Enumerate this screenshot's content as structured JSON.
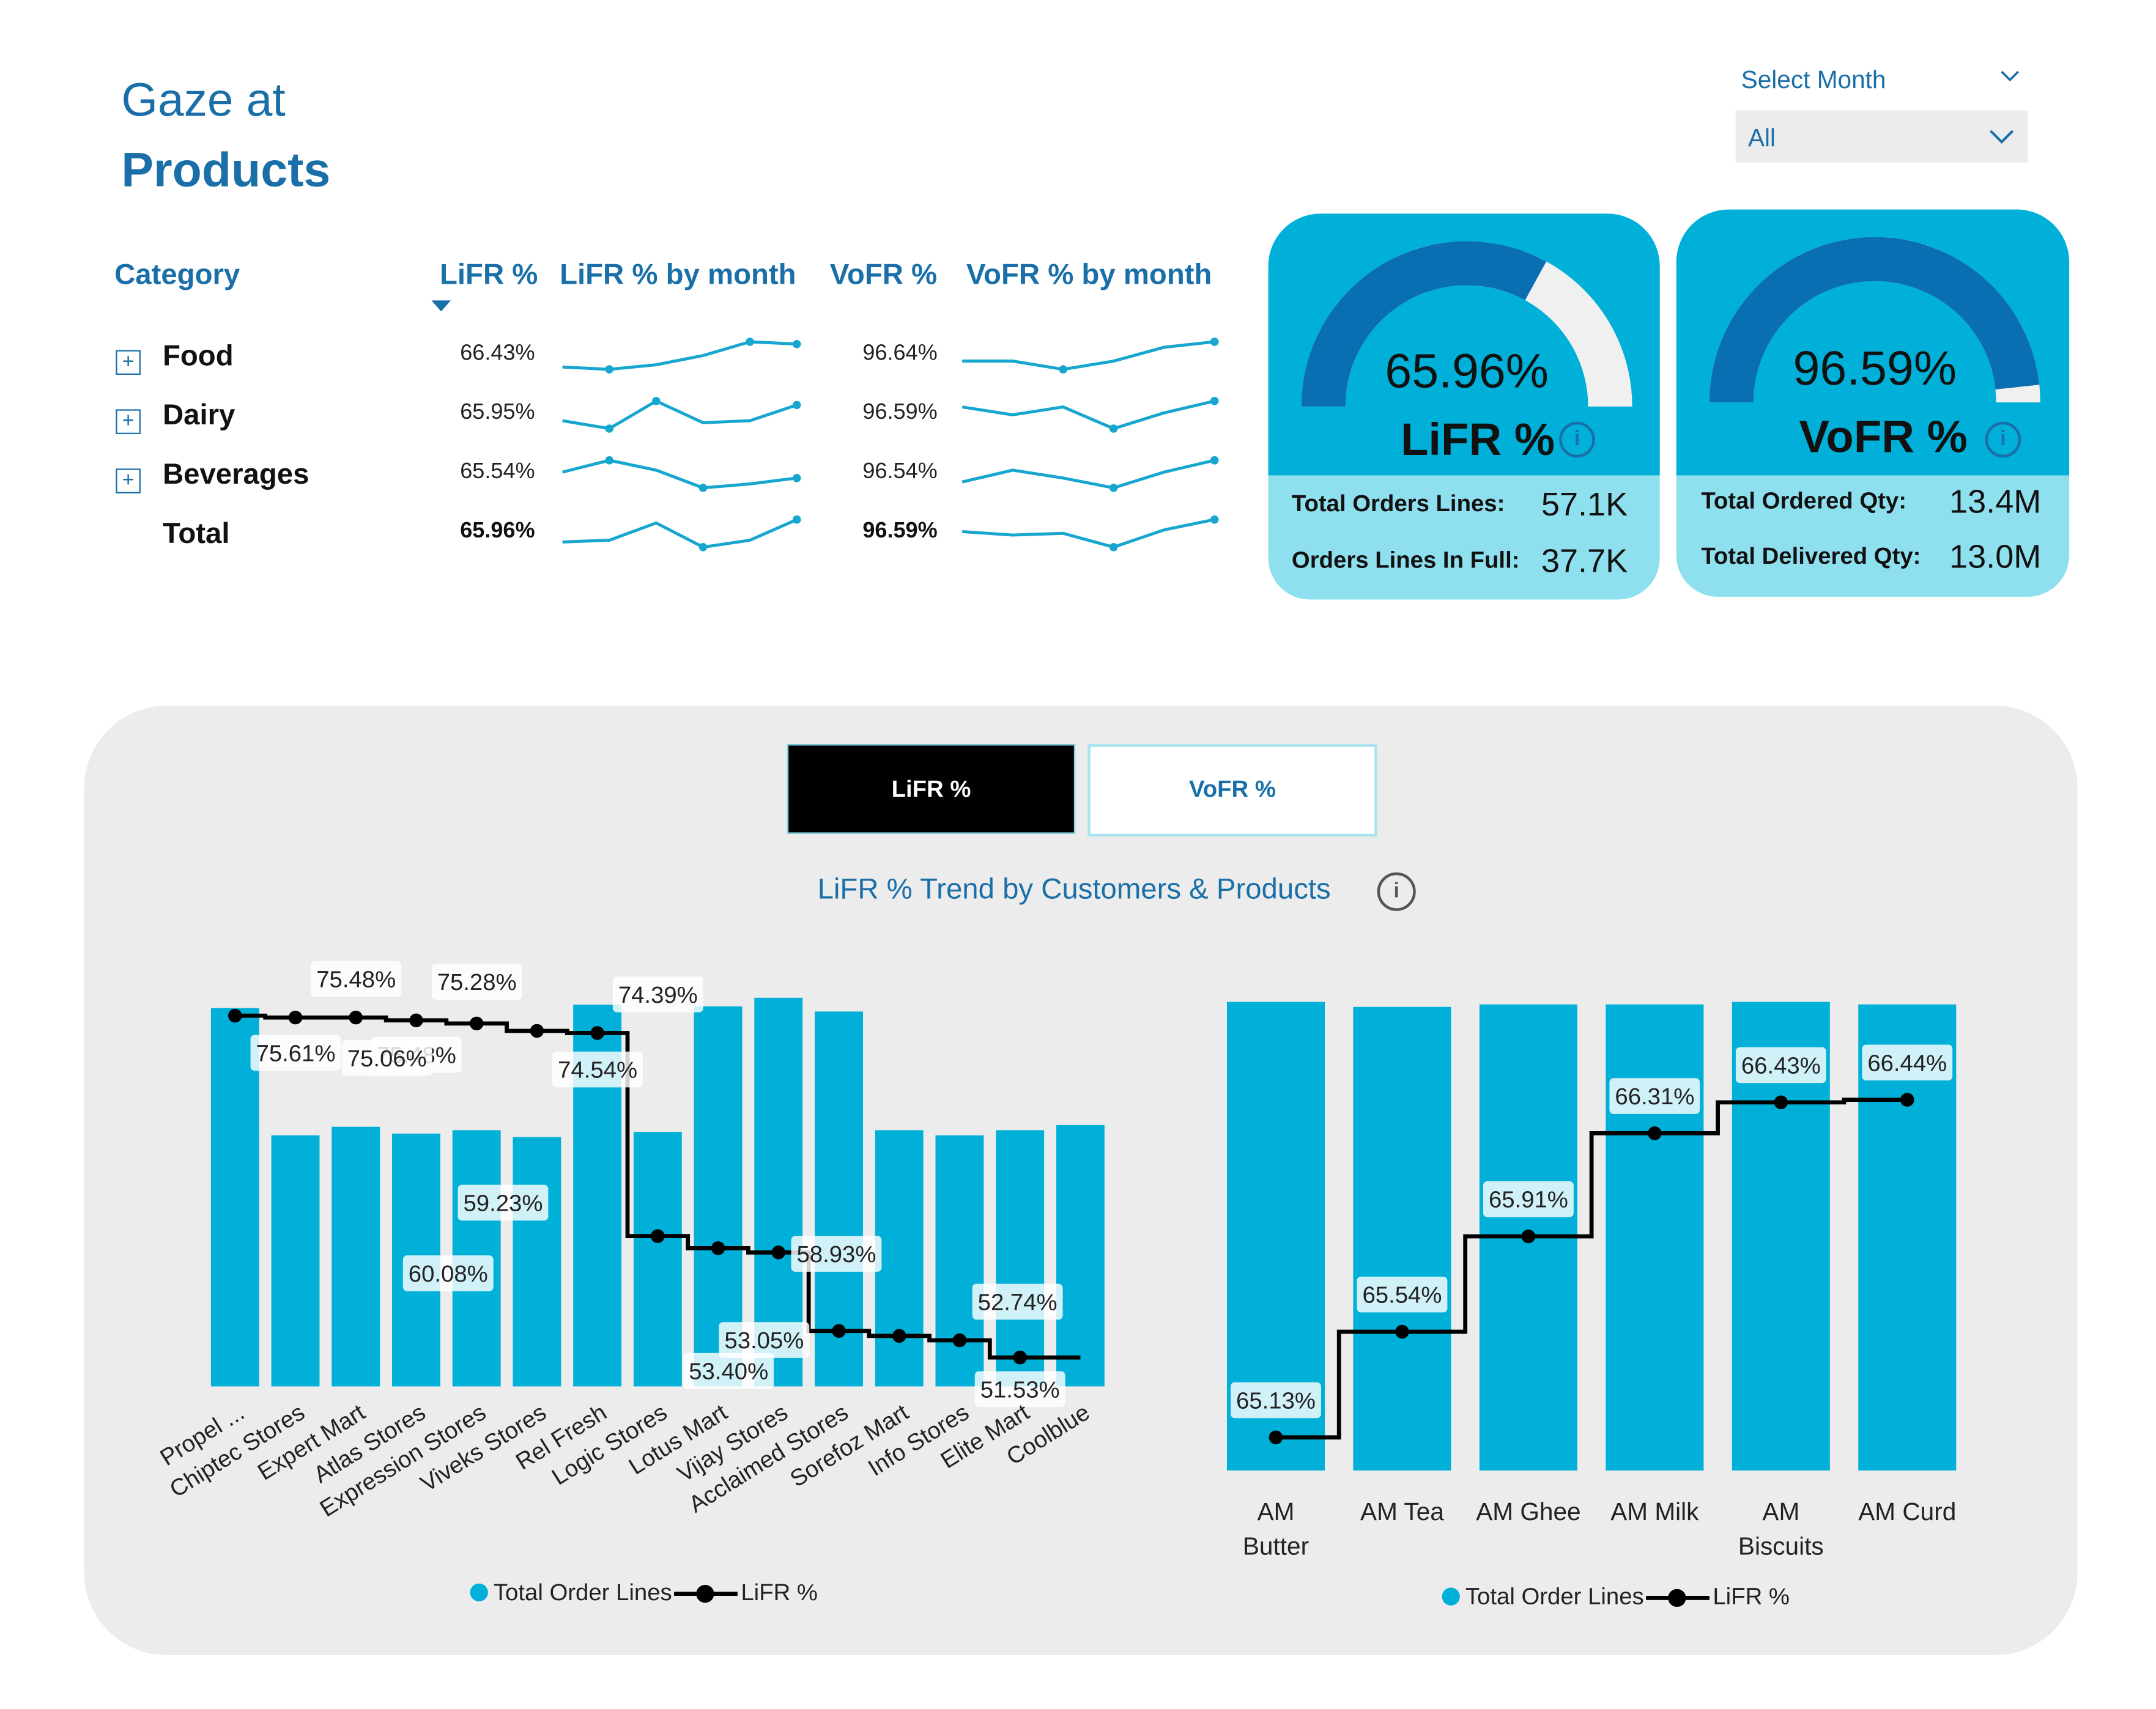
{
  "header": {
    "title_line1": "Gaze at",
    "title_line2": "Products"
  },
  "month_filter": {
    "label": "Select Month",
    "value": "All"
  },
  "matrix": {
    "headers": {
      "category": "Category",
      "lifr": "LiFR %",
      "lifr_month": "LiFR % by month",
      "vofr": "VoFR %",
      "vofr_month": "VoFR % by month"
    },
    "rows": [
      {
        "name": "Food",
        "lifr": "66.43%",
        "vofr": "96.64%",
        "lifr_trend": [
          64.9,
          64.8,
          65.0,
          65.4,
          66.0,
          65.9
        ],
        "vofr_trend": [
          96.3,
          96.3,
          96.0,
          96.3,
          96.8,
          97.0
        ]
      },
      {
        "name": "Dairy",
        "lifr": "65.95%",
        "vofr": "96.59%",
        "lifr_trend": [
          65.3,
          64.9,
          66.3,
          65.2,
          65.3,
          66.1
        ],
        "vofr_trend": [
          96.9,
          96.5,
          96.9,
          95.8,
          96.6,
          97.2
        ]
      },
      {
        "name": "Beverages",
        "lifr": "65.54%",
        "vofr": "96.54%",
        "lifr_trend": [
          65.8,
          66.4,
          65.9,
          65.0,
          65.2,
          65.5
        ],
        "vofr_trend": [
          95.9,
          96.5,
          96.1,
          95.6,
          96.4,
          97.0
        ]
      },
      {
        "name": "Total",
        "lifr": "65.96%",
        "vofr": "96.59%",
        "lifr_trend": [
          64.9,
          65.0,
          66.0,
          64.6,
          65.0,
          66.2
        ],
        "vofr_trend": [
          96.4,
          96.2,
          96.3,
          95.5,
          96.5,
          97.1
        ]
      }
    ]
  },
  "kpi_lifr": {
    "value": "65.96%",
    "label": "LiFR %",
    "gauge_fraction": 0.6596,
    "stat1_label": "Total Orders Lines:",
    "stat1_value": "57.1K",
    "stat2_label": "Orders Lines In Full:",
    "stat2_value": "37.7K"
  },
  "kpi_vofr": {
    "value": "96.59%",
    "label": "VoFR %",
    "gauge_fraction": 0.9659,
    "stat1_label": "Total Ordered Qty:",
    "stat1_value": "13.4M",
    "stat2_label": "Total Delivered Qty:",
    "stat2_value": "13.0M"
  },
  "tabs": {
    "active": "LiFR %",
    "inactive": "VoFR %"
  },
  "chart_title": "LiFR % Trend by Customers & Products",
  "colors": {
    "accent": "#00b0d8",
    "brand_blue": "#1a6fa9",
    "gauge_dark": "#0a6eb3",
    "gauge_track": "#f0f0f0",
    "card_light": "#8fe0ef",
    "panel": "#ececec"
  },
  "chart_data": [
    {
      "type": "bar",
      "title": "",
      "categories": [
        "Propel ...",
        "Chiptec Stores",
        "Expert Mart",
        "Atlas Stores",
        "Expression Stores",
        "Viveks Stores",
        "Rel Fresh",
        "Logic Stores",
        "Lotus Mart",
        "Vijay Stores",
        "Acclaimed Stores",
        "Sorefoz Mart",
        "Info Stores",
        "Elite Mart",
        "Coolblue"
      ],
      "series": [
        {
          "name": "Total Order Lines",
          "type": "bar",
          "values": [
            1100,
            730,
            755,
            735,
            745,
            725,
            1110,
            740,
            1105,
            1130,
            1090,
            745,
            730,
            745,
            760
          ]
        },
        {
          "name": "LiFR %",
          "type": "step-line",
          "values": [
            75.61,
            75.48,
            75.48,
            75.28,
            75.06,
            74.54,
            74.39,
            60.08,
            59.23,
            58.93,
            53.4,
            53.05,
            52.74,
            51.53,
            51.53
          ],
          "labels": [
            "75.61%",
            "75.48%",
            "75.48%",
            "75.28%",
            "75.06%",
            "74.54%",
            "74.39%",
            "60.08%",
            "59.23%",
            "58.93%",
            "53.40%",
            "53.05%",
            "52.74%",
            "51.53%",
            ""
          ]
        }
      ],
      "legend": [
        "Total Order Lines",
        "LiFR %"
      ],
      "legend_position": "bottom"
    },
    {
      "type": "bar",
      "title": "",
      "categories": [
        "AM Butter",
        "AM Tea",
        "AM Ghee",
        "AM Milk",
        "AM Biscuits",
        "AM Curd"
      ],
      "series": [
        {
          "name": "Total Order Lines",
          "type": "bar",
          "values": [
            9450,
            9350,
            9400,
            9400,
            9450,
            9400
          ]
        },
        {
          "name": "LiFR %",
          "type": "step-line",
          "values": [
            65.13,
            65.54,
            65.91,
            66.31,
            66.43,
            66.44
          ],
          "labels": [
            "65.13%",
            "65.54%",
            "65.91%",
            "66.31%",
            "66.43%",
            "66.44%"
          ]
        }
      ],
      "legend": [
        "Total Order Lines",
        "LiFR %"
      ],
      "legend_position": "bottom"
    }
  ]
}
